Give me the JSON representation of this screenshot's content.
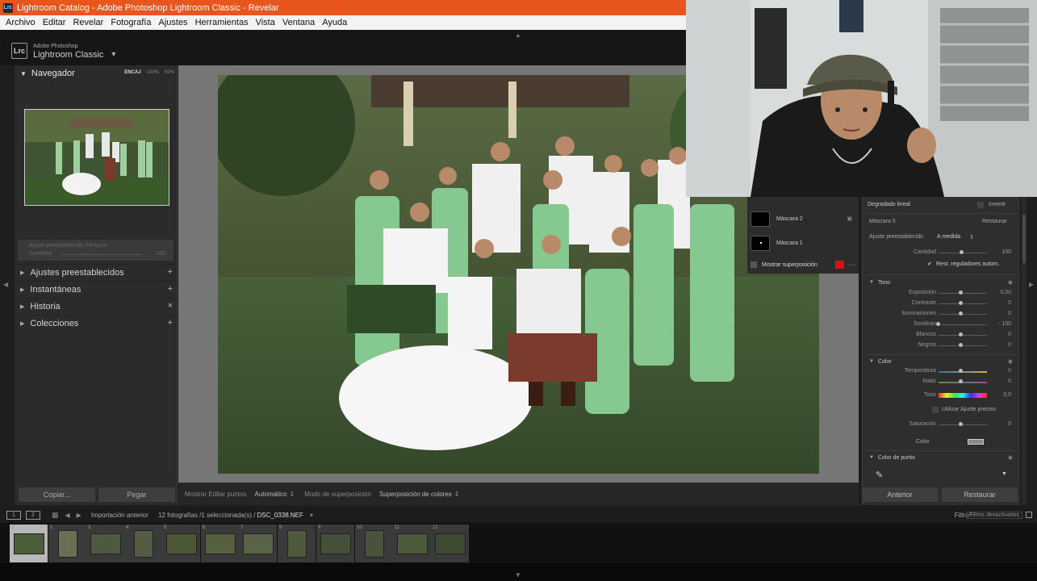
{
  "window": {
    "title": "Lightroom Catalog - Adobe Photoshop Lightroom Classic - Revelar"
  },
  "menu": [
    "Archivo",
    "Editar",
    "Revelar",
    "Fotografía",
    "Ajustes",
    "Herramientas",
    "Vista",
    "Ventana",
    "Ayuda"
  ],
  "brand": {
    "line1": "Adobe Photoshop",
    "line2": "Lightroom Classic",
    "logo": "Lrc"
  },
  "navigator": {
    "title": "Navegador",
    "zoom_options": [
      "ENCAJ",
      "100%",
      "50%"
    ]
  },
  "preset_box": {
    "label": "Ajuste preestablecido: Ninguno",
    "amount_label": "Cantidad",
    "amount_value": "100"
  },
  "left_panels": [
    {
      "label": "Ajustes preestablecidos",
      "action": "+"
    },
    {
      "label": "Instantáneas",
      "action": "+"
    },
    {
      "label": "Historia",
      "action": "×"
    },
    {
      "label": "Colecciones",
      "action": "+"
    }
  ],
  "left_buttons": {
    "copy": "Copiar...",
    "paste": "Pegar"
  },
  "toolbar": {
    "edit_points_label": "Mostrar Editar puntos",
    "edit_points_value": "Automático",
    "overlay_mode_label": "Modo de superposición",
    "overlay_mode_value": "Superposición de colores"
  },
  "mask_panel": {
    "masks": [
      "Máscara 2",
      "Máscara 1"
    ],
    "show_overlay": "Mostrar superposición",
    "overlay_color": "#d21414"
  },
  "right_panel": {
    "mask_type": "Degradado lineal",
    "invert_label": "Invertir",
    "mask_name": "Máscara 5",
    "reset_label": "Restaurar",
    "preset_label": "Ajuste preestablecido",
    "preset_value": "A medida",
    "amount_label": "Cantidad",
    "amount_value": "100",
    "auto_reset_label": "Rest. reguladores autom.",
    "tone": {
      "title": "Tono",
      "sliders": [
        {
          "label": "Exposición",
          "value": "0,00"
        },
        {
          "label": "Contraste",
          "value": "0"
        },
        {
          "label": "Iluminaciones",
          "value": "0"
        },
        {
          "label": "Sombras",
          "value": "- 100"
        },
        {
          "label": "Blancos",
          "value": "0"
        },
        {
          "label": "Negros",
          "value": "0"
        }
      ]
    },
    "color": {
      "title": "Color",
      "sliders": [
        {
          "label": "Temperatura",
          "value": "0"
        },
        {
          "label": "Matiz",
          "value": "0"
        },
        {
          "label": "Tono",
          "value": "0,0"
        }
      ],
      "fine_adjust": "Utilizar Ajuste preciso",
      "saturation_label": "Saturación",
      "saturation_value": "0",
      "color_label": "Color"
    },
    "point_color": {
      "title": "Color de punto"
    },
    "buttons": {
      "previous": "Anterior",
      "reset": "Restaurar"
    }
  },
  "filmbar": {
    "view1": "1",
    "view2": "2",
    "source": "Importación anterior",
    "count": "12 fotografías /1 seleccionada(s) /",
    "filename": "DSC_0338.NEF",
    "filter_label": "Filtro :",
    "filter_value": "Filtros desactivados"
  },
  "thumbnails": [
    "1",
    "2",
    "3",
    "4",
    "5",
    "6",
    "7",
    "8",
    "9",
    "10",
    "11",
    "12"
  ]
}
